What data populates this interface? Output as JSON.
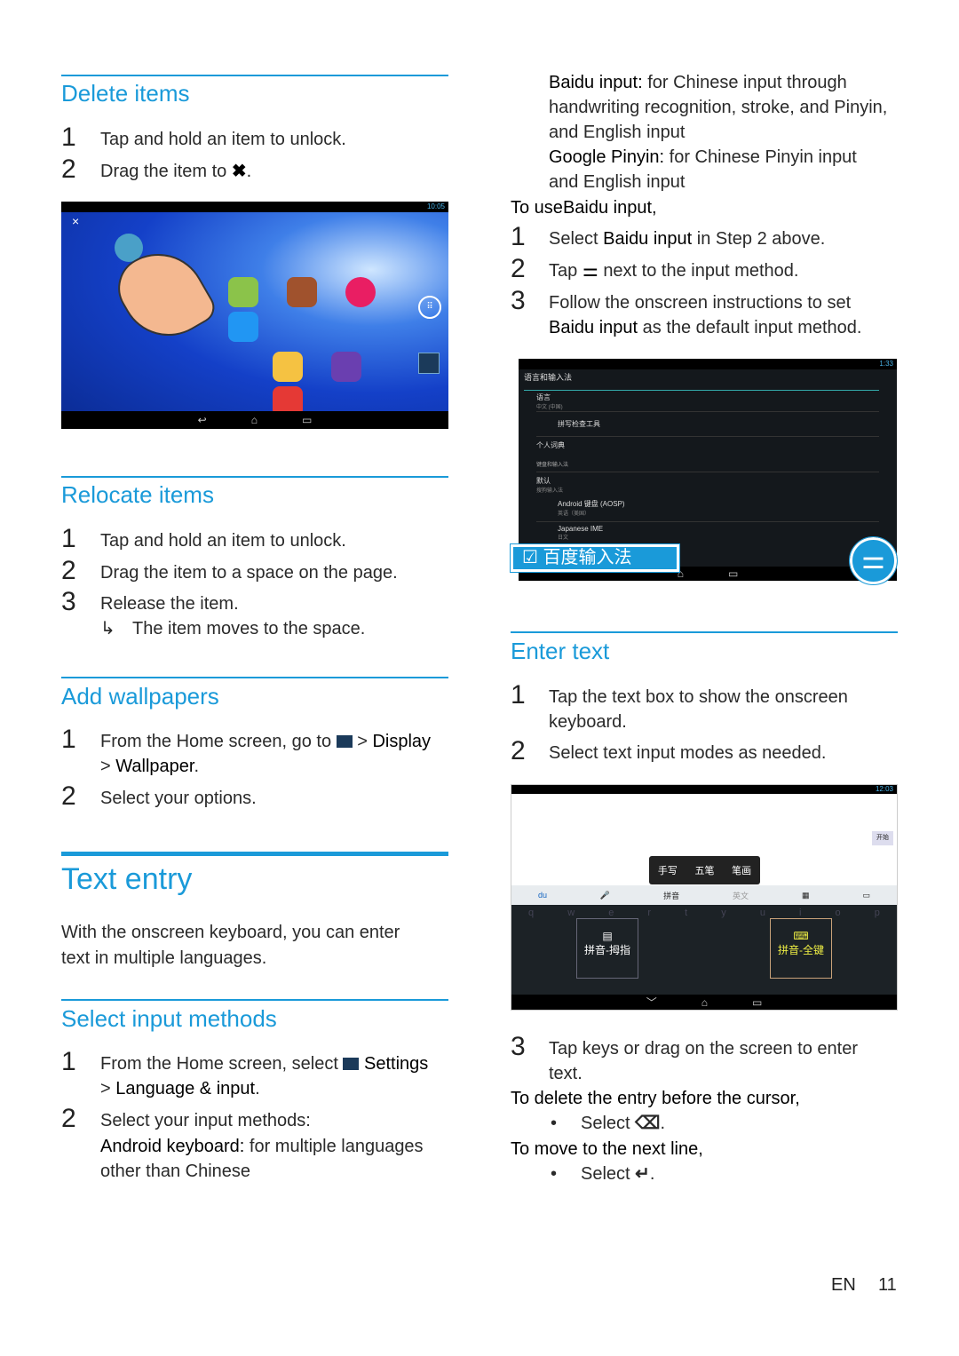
{
  "left": {
    "delete": {
      "title": "Delete items",
      "steps": [
        {
          "n": "1",
          "text": "Tap and hold an item to unlock."
        },
        {
          "n": "2",
          "text": "Drag the item to",
          "icon": "close-x-icon",
          "tail": "."
        }
      ]
    },
    "home_screenshot": {
      "time": "10:05",
      "nav": [
        "back",
        "home",
        "recent"
      ]
    },
    "relocate": {
      "title": "Relocate items",
      "steps": [
        {
          "n": "1",
          "text": "Tap and hold an item to unlock."
        },
        {
          "n": "2",
          "text": "Drag the item to a space on the page."
        },
        {
          "n": "3",
          "text": "Release the item."
        }
      ],
      "result": "The item moves to the space."
    },
    "wallpapers": {
      "title": "Add wallpapers",
      "step1_a": "From the Home screen, go to",
      "step1_b": "> ",
      "step1_display": "Display",
      "step1_c": "> ",
      "step1_wallpaper": "Wallpaper",
      "step1_end": ".",
      "step2": "Select your options.",
      "n1": "1",
      "n2": "2"
    },
    "text_entry": {
      "title": "Text entry",
      "para1": "With the onscreen keyboard, you can enter",
      "para2": "text in multiple languages."
    },
    "select_input": {
      "title": "Select input methods",
      "n1": "1",
      "s1a": "From the Home screen, select",
      "s1_settings": "Settings",
      "s1b": "> ",
      "s1_lang": "Language & input",
      "s1_end": ".",
      "n2": "2",
      "s2": "Select your input methods:",
      "android_label": "Android keyboard:",
      "android_text": " for multiple languages",
      "android_text2": "other than Chinese"
    }
  },
  "right": {
    "baidu_label": "Baidu input:",
    "baidu_text": " for Chinese input through",
    "baidu_text2": "handwriting recognition, stroke, and Pinyin,",
    "baidu_text3": "and English input",
    "google_label": "Google Pinyin:",
    "google_text": " for Chinese Pinyin input",
    "google_text2": "and English input",
    "to_use_a": "To use",
    "to_use_b": "Baidu input",
    ",": ",",
    "steps": {
      "n1": "1",
      "s1a": "Select ",
      "s1b": "Baidu input",
      "s1c": " in Step 2 above.",
      "n2": "2",
      "s2a": "Tap",
      "s2b": "next to the input method.",
      "n3": "3",
      "s3a": "Follow the onscreen instructions to set",
      "s3b": "Baidu input",
      "s3c": " as the default input method."
    },
    "settings_screenshot": {
      "time": "1:33",
      "header": "语言和输入法",
      "lang": "语言",
      "lang_val": "中文 (中国)",
      "spell": "拼写检查工具",
      "dict": "个人词典",
      "kb_section": "键盘和输入法",
      "default": "默认",
      "default_val": "搜狗输入法",
      "android_kb": "Android 键盘 (AOSP)",
      "android_kb_sub": "英语（美国）",
      "japanese": "Japanese IME",
      "japanese_sub": "日文",
      "baidu_callout": "百度输入法"
    },
    "enter": {
      "title": "Enter text",
      "n1": "1",
      "s1a": "Tap the text box to show the onscreen",
      "s1b": "keyboard.",
      "n2": "2",
      "s2": "Select text input modes as needed.",
      "n3": "3",
      "s3a": "Tap keys or drag on the screen to enter",
      "s3b": "text."
    },
    "keyboard_screenshot": {
      "time": "12:03",
      "send": "开始",
      "popup": [
        "手写",
        "五笔",
        "笔画"
      ],
      "bar": [
        "拼音",
        "英文"
      ],
      "mode1": "拼音-拇指",
      "mode2": "拼音-全键",
      "keys_row1": [
        "q",
        "w",
        "e",
        "r",
        "t",
        "y",
        "u",
        "i",
        "o",
        "p"
      ]
    },
    "delete_hint": "To delete the entry before the cursor,",
    "select": "Select",
    "newline_hint": "To move to the next line,",
    "bullet": "•"
  },
  "footer": {
    "lang": "EN",
    "page": "11"
  }
}
